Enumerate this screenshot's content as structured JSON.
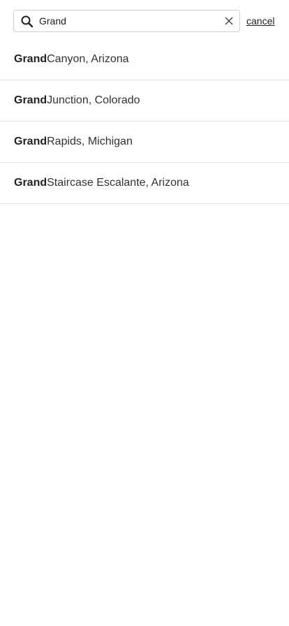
{
  "search": {
    "value": "Grand",
    "placeholder": "",
    "cancel_label": "cancel"
  },
  "icons": {
    "search": "search-icon",
    "clear": "close-icon"
  },
  "results": [
    {
      "match": "Grand",
      "rest": " Canyon, Arizona"
    },
    {
      "match": "Grand",
      "rest": " Junction, Colorado"
    },
    {
      "match": "Grand",
      "rest": " Rapids, Michigan"
    },
    {
      "match": "Grand",
      "rest": " Staircase Escalante, Arizona"
    }
  ]
}
